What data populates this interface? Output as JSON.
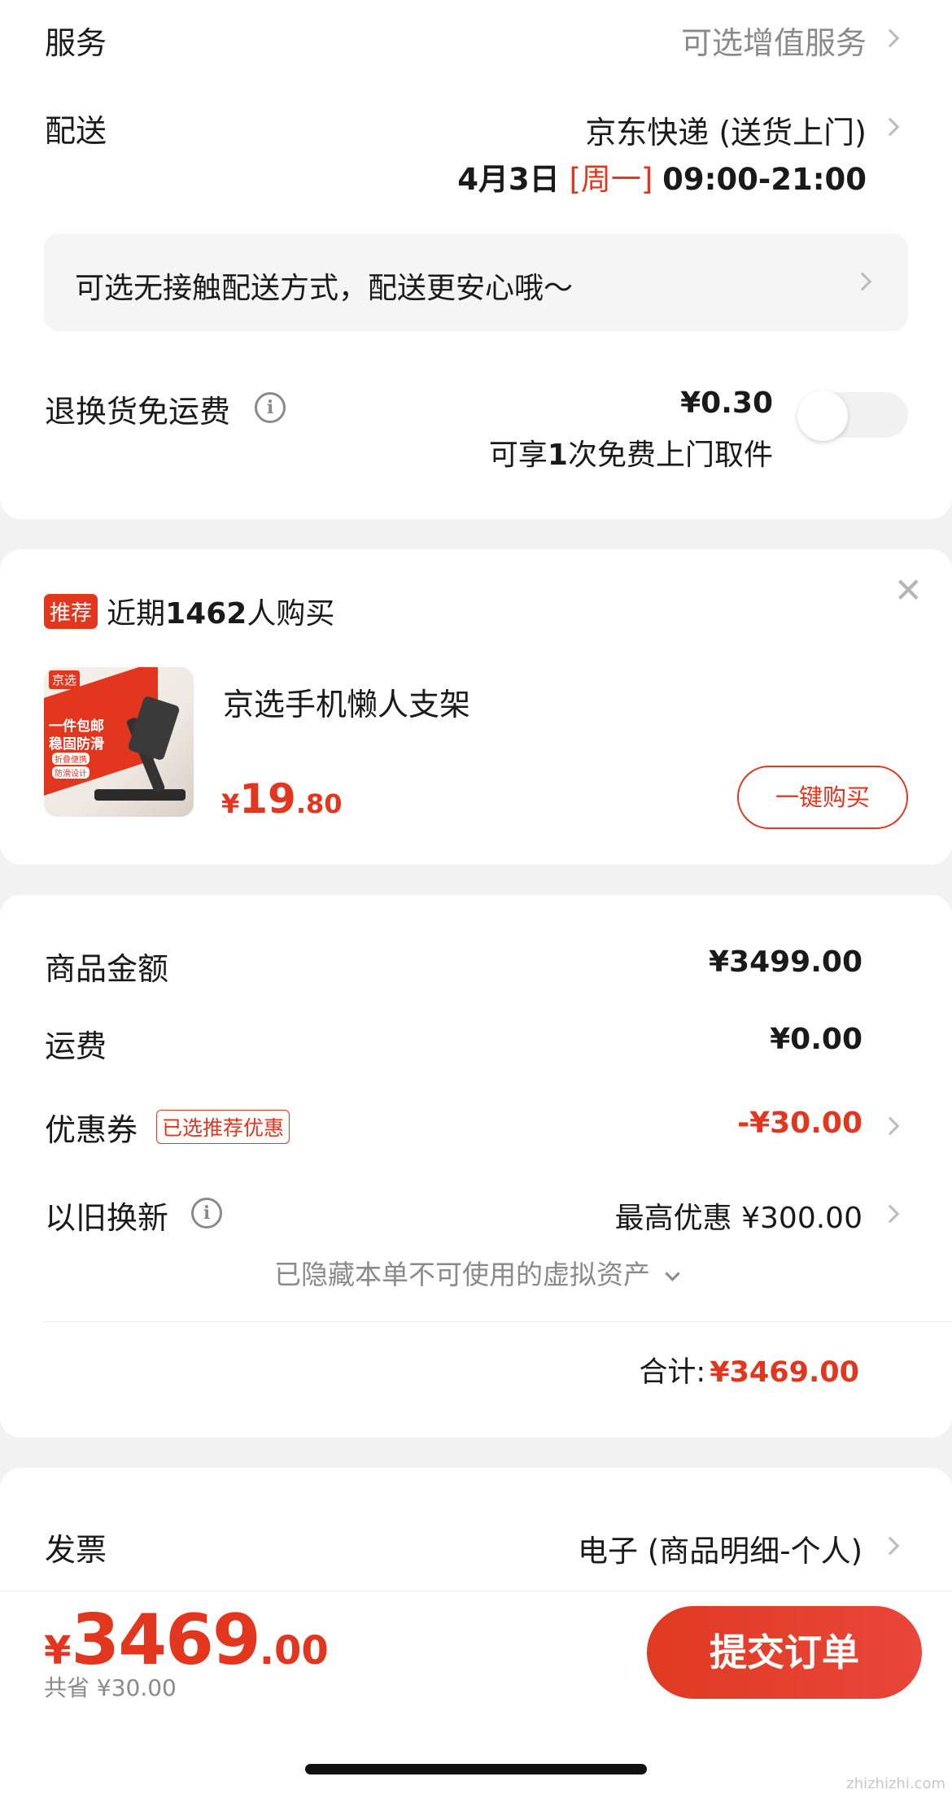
{
  "service": {
    "label": "服务",
    "value": "可选增值服务"
  },
  "delivery": {
    "label": "配送",
    "method": "京东快递 (送货上门)",
    "date": "4月3日",
    "weekday": "[周一]",
    "time": "09:00-21:00",
    "contactless_tip": "可选无接触配送方式，配送更安心哦～"
  },
  "return_shipping": {
    "label": "退换货免运费",
    "price": "¥0.30",
    "note_prefix": "可享",
    "note_count": "1",
    "note_suffix": "次免费上门取件",
    "toggle_on": false
  },
  "recommend": {
    "badge": "推荐",
    "headline_prefix": "近期",
    "headline_count": "1462",
    "headline_suffix": "人购买",
    "product_name": "京选手机懒人支架",
    "price_symbol": "¥",
    "price_int": "19",
    "price_dec": ".80",
    "buy_label": "一键购买",
    "image_brand": "京选",
    "image_line1": "一件包邮",
    "image_line2": "稳固防滑",
    "image_tag1": "折叠便携",
    "image_tag2": "防滑设计"
  },
  "summary": {
    "goods_label": "商品金额",
    "goods_value": "¥3499.00",
    "shipping_label": "运费",
    "shipping_value": "¥0.00",
    "coupon_label": "优惠券",
    "coupon_badge": "已选推荐优惠",
    "coupon_value": "-¥30.00",
    "tradein_label": "以旧换新",
    "tradein_value": "最高优惠 ¥300.00",
    "hidden_assets": "已隐藏本单不可使用的虚拟资产",
    "total_label": "合计:",
    "total_value": "¥3469.00"
  },
  "invoice": {
    "label": "发票",
    "value": "电子 (商品明细-个人)"
  },
  "bottom": {
    "price_symbol": "¥",
    "price_int": "3469",
    "price_dec": ".00",
    "saved": "共省 ¥30.00",
    "submit_label": "提交订单"
  },
  "watermark": {
    "text": "zhizhizhi.com"
  },
  "colors": {
    "accent": "#e2361f",
    "muted": "#8a8a8a",
    "background": "#f2f2f2"
  }
}
